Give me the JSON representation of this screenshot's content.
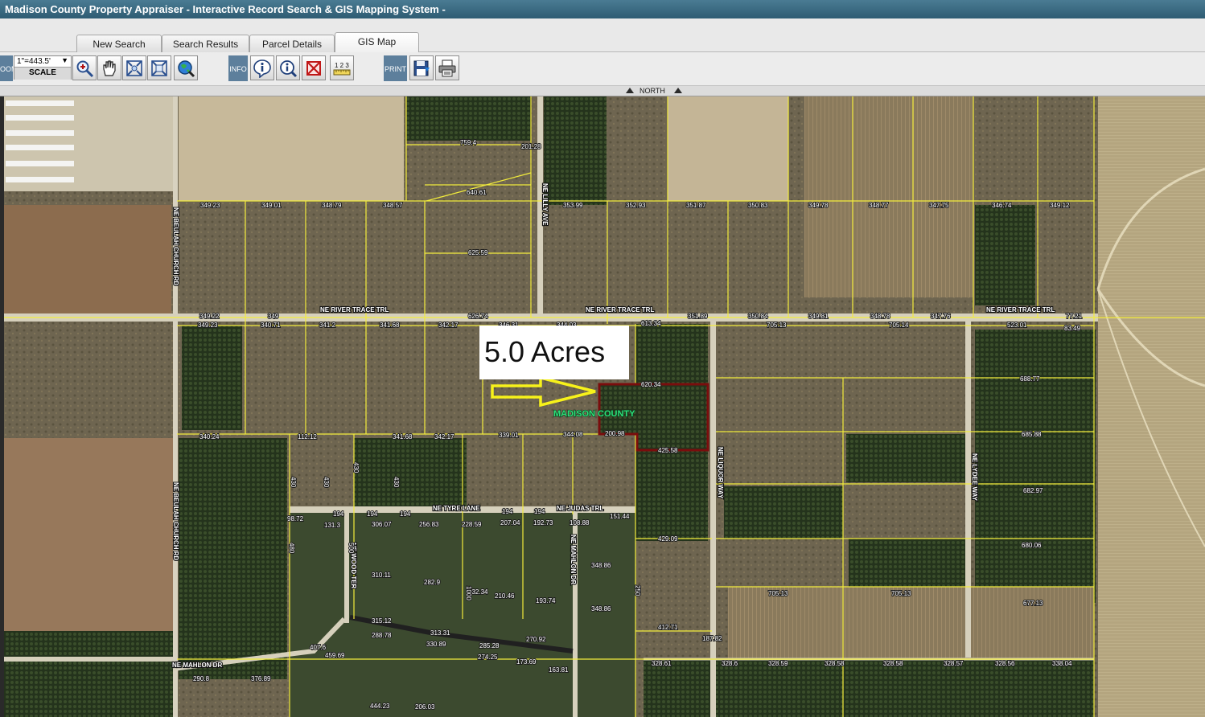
{
  "window": {
    "title": "Madison County Property Appraiser - Interactive Record Search & GIS Mapping System -"
  },
  "tabs": [
    {
      "label": "New Search",
      "active": false
    },
    {
      "label": "Search Results",
      "active": false
    },
    {
      "label": "Parcel Details",
      "active": false
    },
    {
      "label": "GIS Map",
      "active": true
    }
  ],
  "toolbar": {
    "zoom_label": "OOM",
    "scale_value": "1\"=443.5'",
    "scale_label": "SCALE",
    "info_label": "INFO",
    "print_label": "PRINT",
    "zoom_tools": [
      "zoom-in-icon",
      "pan-hand-icon",
      "zoom-extent-icon",
      "zoom-out-icon",
      "globe-icon"
    ],
    "info_tools": [
      "identify-info-icon",
      "query-info-icon",
      "clear-selection-icon",
      "measure-ruler-icon"
    ],
    "print_tools": [
      "save-disk-icon",
      "print-icon"
    ],
    "ruler_text": "1 2 3"
  },
  "map": {
    "north_label": "NORTH",
    "callout": "5.0 Acres",
    "county_label": "MADISON COUNTY",
    "roads": [
      "NE RIVER TRACE TRL",
      "NE RIVER TRACE TRL",
      "NE RIVER TRACE TRL",
      "NE LILLY AVE",
      "NE BEULAH CHURCH RD",
      "NE BEULAH CHURCH RD",
      "NE TYRE LANE",
      "NE JUDAS TRL",
      "NE LIQUOR WAY",
      "NE LYDEE WAY",
      "NE WOOD TER",
      "NE MAHLON DR",
      "NE MAHLON DR"
    ],
    "dims": [
      "759.4",
      "201.28",
      "349.23",
      "349.01",
      "348.79",
      "348.57",
      "353.99",
      "352.93",
      "351.87",
      "350.83",
      "349.78",
      "348.77",
      "347.75",
      "346.74",
      "349.12",
      "640.61",
      "625.59",
      "349.22",
      "349",
      "626.74",
      "351.89",
      "350.84",
      "349.81",
      "348.78",
      "347.76",
      "77.21",
      "349.23",
      "340.71",
      "341.2",
      "341.68",
      "342.17",
      "346.31",
      "344.03",
      "613.34",
      "705.13",
      "705.14",
      "523.01",
      "83.49",
      "688.77",
      "685.88",
      "682.97",
      "680.06",
      "677.13",
      "620.34",
      "200.98",
      "425.58",
      "340.24",
      "112.12",
      "341.68",
      "342.17",
      "339.01",
      "344.08",
      "98.72",
      "194",
      "194",
      "194",
      "194",
      "194",
      "131.3",
      "306.07",
      "256.83",
      "228.59",
      "207.04",
      "192.73",
      "108.88",
      "151.44",
      "429.09",
      "310.11",
      "282.9",
      "232.34",
      "210.46",
      "193.74",
      "348.86",
      "348.86",
      "705.13",
      "705.13",
      "412.71",
      "187.82",
      "328.61",
      "328.6",
      "328.59",
      "328.58",
      "328.58",
      "328.57",
      "328.56",
      "338.04",
      "290.8",
      "376.89",
      "444.23",
      "206.03",
      "288.78",
      "313.31",
      "330.89",
      "285.28",
      "270.92",
      "274.25",
      "173.69",
      "163.81",
      "315.12",
      "407.6",
      "459.69",
      "430",
      "430",
      "430",
      "430",
      "480",
      "500",
      "1000",
      "250",
      "320"
    ]
  }
}
